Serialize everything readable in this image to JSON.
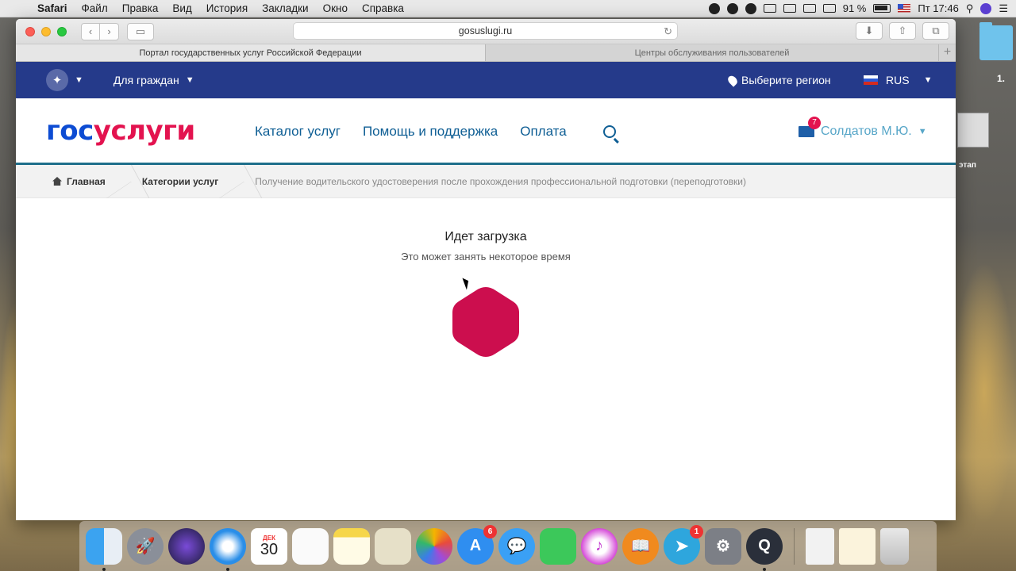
{
  "menubar": {
    "app_name": "Safari",
    "items": [
      "Файл",
      "Правка",
      "Вид",
      "История",
      "Закладки",
      "Окно",
      "Справка"
    ],
    "battery": "91 %",
    "clock": "Пт 17:46"
  },
  "desktop": {
    "label1": "1.",
    "label2": "этап"
  },
  "browser": {
    "url": "gosuslugi.ru",
    "tabs": [
      {
        "title": "Портал государственных услуг Российской Федерации"
      },
      {
        "title": "Центры обслуживания пользователей"
      }
    ],
    "add_tab": "+"
  },
  "site": {
    "topbar": {
      "audience": "Для граждан",
      "region": "Выберите регион",
      "language": "RUS"
    },
    "logo": {
      "part1": "гос",
      "part2": "услуги"
    },
    "nav": [
      "Каталог услуг",
      "Помощь и поддержка",
      "Оплата"
    ],
    "user": {
      "name": "Солдатов М.Ю.",
      "mail_count": "7"
    },
    "breadcrumb": {
      "home": "Главная",
      "category": "Категории услуг",
      "current": "Получение водительского удостоверения после прохождения профессиональной подготовки (переподготовки)"
    },
    "loading": {
      "title": "Идет загрузка",
      "subtitle": "Это может занять некоторое время"
    },
    "colors": {
      "topbar": "#253a8a",
      "logo_blue": "#0d4cd3",
      "logo_red": "#e3134f",
      "spinner": "#cc0e4e"
    }
  },
  "dock": {
    "calendar_month": "ДЕК",
    "calendar_day": "30",
    "appstore_badge": "6",
    "telegram_badge": "1"
  }
}
